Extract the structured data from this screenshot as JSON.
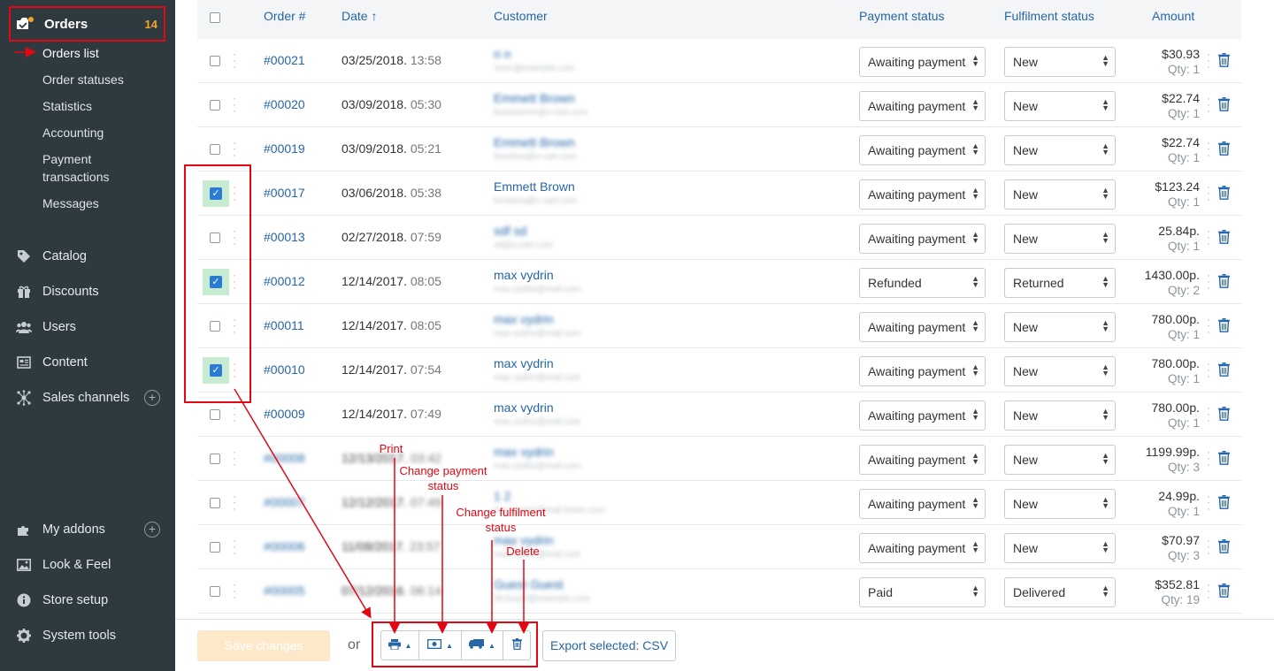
{
  "sidebar": {
    "orders": {
      "label": "Orders",
      "count": "14"
    },
    "sub_items": [
      "Orders list",
      "Order statuses",
      "Statistics",
      "Accounting",
      "Payment",
      "transactions",
      "Messages"
    ],
    "items": [
      {
        "label": "Catalog",
        "icon": "tag-icon"
      },
      {
        "label": "Discounts",
        "icon": "gift-icon"
      },
      {
        "label": "Users",
        "icon": "users-icon"
      },
      {
        "label": "Content",
        "icon": "content-icon"
      },
      {
        "label": "Sales channels",
        "icon": "share-icon"
      },
      {
        "label": "My addons",
        "icon": "puzzle-icon"
      },
      {
        "label": "Look & Feel",
        "icon": "image-icon"
      },
      {
        "label": "Store setup",
        "icon": "info-icon"
      },
      {
        "label": "System tools",
        "icon": "gear-icon"
      }
    ]
  },
  "table": {
    "headers": {
      "order": "Order #",
      "date": "Date ↑",
      "customer": "Customer",
      "payment": "Payment status",
      "fulfilment": "Fulfilment status",
      "amount": "Amount"
    },
    "rows": [
      {
        "order": "#00021",
        "date": "03/25/2018.",
        "time": "13:58",
        "name": "n n",
        "email": "nnnn@example.com",
        "payment": "Awaiting payment",
        "fulfilment": "New",
        "amount": "$30.93",
        "qty": "Qty: 1",
        "checked": false,
        "blur": true,
        "blur_order": false
      },
      {
        "order": "#00020",
        "date": "03/09/2018.",
        "time": "05:30",
        "name": "Emmett Brown",
        "email": "brownemm@x-cart.com",
        "payment": "Awaiting payment",
        "fulfilment": "New",
        "amount": "$22.74",
        "qty": "Qty: 1",
        "checked": false,
        "blur": true,
        "blur_order": false
      },
      {
        "order": "#00019",
        "date": "03/09/2018.",
        "time": "05:21",
        "name": "Emmett Brown",
        "email": "lenshina@x-cart.com",
        "payment": "Awaiting payment",
        "fulfilment": "New",
        "amount": "$22.74",
        "qty": "Qty: 1",
        "checked": false,
        "blur": true,
        "blur_order": false
      },
      {
        "order": "#00017",
        "date": "03/06/2018.",
        "time": "05:38",
        "name": "Emmett Brown",
        "email": "lenshina@x-cart.com",
        "payment": "Awaiting payment",
        "fulfilment": "New",
        "amount": "$123.24",
        "qty": "Qty: 1",
        "checked": true,
        "blur": false,
        "blur_order": false
      },
      {
        "order": "#00013",
        "date": "02/27/2018.",
        "time": "07:59",
        "name": "sdf sd",
        "email": "sd@x-cart.com",
        "payment": "Awaiting payment",
        "fulfilment": "New",
        "amount": "25.84p.",
        "qty": "Qty: 1",
        "checked": false,
        "blur": true,
        "blur_order": false
      },
      {
        "order": "#00012",
        "date": "12/14/2017.",
        "time": "08:05",
        "name": "max vydrin",
        "email": "max.vydrin@mail.com",
        "payment": "Refunded",
        "fulfilment": "Returned",
        "amount": "1430.00p.",
        "qty": "Qty: 2",
        "checked": true,
        "blur": false,
        "blur_order": false
      },
      {
        "order": "#00011",
        "date": "12/14/2017.",
        "time": "08:05",
        "name": "max vydrin",
        "email": "max.vydrin@mail.com",
        "payment": "Awaiting payment",
        "fulfilment": "New",
        "amount": "780.00p.",
        "qty": "Qty: 1",
        "checked": false,
        "blur": true,
        "blur_order": false
      },
      {
        "order": "#00010",
        "date": "12/14/2017.",
        "time": "07:54",
        "name": "max vydrin",
        "email": "max.vydrin@mail.com",
        "payment": "Awaiting payment",
        "fulfilment": "New",
        "amount": "780.00p.",
        "qty": "Qty: 1",
        "checked": true,
        "blur": false,
        "blur_order": false
      },
      {
        "order": "#00009",
        "date": "12/14/2017.",
        "time": "07:49",
        "name": "max vydrin",
        "email": "max.vydrin@mail.com",
        "payment": "Awaiting payment",
        "fulfilment": "New",
        "amount": "780.00p.",
        "qty": "Qty: 1",
        "checked": false,
        "blur": false,
        "blur_order": false
      },
      {
        "order": "#00008",
        "date": "12/13/2017.",
        "time": "03:42",
        "name": "max vydrin",
        "email": "max.vydrin@mail.com",
        "payment": "Awaiting payment",
        "fulfilment": "New",
        "amount": "1199.99p.",
        "qty": "Qty: 3",
        "checked": false,
        "blur": true,
        "blur_order": true
      },
      {
        "order": "#00007",
        "date": "12/12/2017.",
        "time": "07:49",
        "name": "1 2",
        "email": "max.vydrin@mail.tester.com",
        "payment": "Awaiting payment",
        "fulfilment": "New",
        "amount": "24.99p.",
        "qty": "Qty: 1",
        "checked": false,
        "blur": true,
        "blur_order": true
      },
      {
        "order": "#00006",
        "date": "11/08/2017.",
        "time": "23:57",
        "name": "max vydrin",
        "email": "max.vydrin@mail.com",
        "payment": "Awaiting payment",
        "fulfilment": "New",
        "amount": "$70.97",
        "qty": "Qty: 3",
        "checked": false,
        "blur": true,
        "blur_order": true
      },
      {
        "order": "#00005",
        "date": "07/12/2016.",
        "time": "06:14",
        "name": "Guest Guest",
        "email": "bit-buyer@example.com",
        "payment": "Paid",
        "fulfilment": "Delivered",
        "amount": "$352.81",
        "qty": "Qty: 19",
        "checked": false,
        "blur": true,
        "blur_order": true
      }
    ]
  },
  "bottom": {
    "save_label": "Save changes",
    "or_label": "or",
    "export_label": "Export selected: CSV"
  },
  "annotations": {
    "print": "Print",
    "change_payment": "Change payment status",
    "change_fulfilment": "Change fulfilment status",
    "delete": "Delete"
  },
  "colors": {
    "sidebar_bg": "#2f3a40",
    "link": "#2566a8",
    "annotation": "#e30613",
    "badge": "#f5a623",
    "checked_bg": "#c7ecd2"
  }
}
